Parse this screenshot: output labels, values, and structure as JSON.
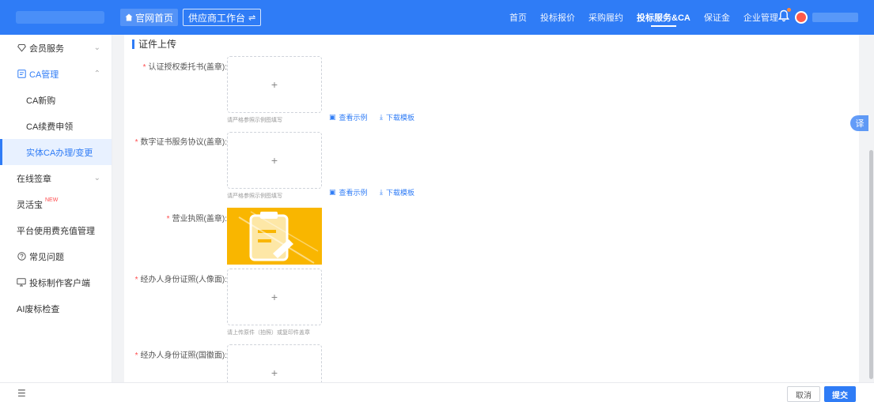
{
  "header": {
    "home_label": "官网首页",
    "workbench_label": "供应商工作台",
    "swap_icon": "⇌",
    "nav": [
      "首页",
      "投标报价",
      "采购履约",
      "投标服务&CA",
      "保证金",
      "企业管理"
    ],
    "active_nav": "投标服务&CA"
  },
  "sidebar": {
    "items": [
      {
        "label": "会员服务",
        "icon": "diamond-icon"
      },
      {
        "label": "CA管理",
        "icon": "ca-card-icon"
      },
      {
        "label": "CA新购"
      },
      {
        "label": "CA续费申领"
      },
      {
        "label": "实体CA办理/变更"
      },
      {
        "label": "在线签章"
      },
      {
        "label": "灵活宝",
        "badge": "NEW"
      },
      {
        "label": "平台使用费充值管理"
      },
      {
        "label": "常见问题",
        "icon": "question-icon"
      },
      {
        "label": "投标制作客户端",
        "icon": "monitor-icon"
      },
      {
        "label": "AI废标检查"
      }
    ]
  },
  "main": {
    "section_title": "证件上传",
    "fields": [
      {
        "label": "认证授权委托书(盖章):",
        "required": true,
        "hint": "请严格参照示例图填写",
        "view_example": "查看示例",
        "download": "下载模板"
      },
      {
        "label": "数字证书服务协议(盖章):",
        "required": true,
        "hint": "请严格参照示例图填写",
        "view_example": "查看示例",
        "download": "下载模板"
      },
      {
        "label": "营业执照(盖章):",
        "required": true
      },
      {
        "label": "经办人身份证照(人像面):",
        "required": true,
        "hint": "请上传原件（拍照）或复印件盖章"
      },
      {
        "label": "经办人身份证照(国徽面):",
        "required": true
      }
    ],
    "plus": "+",
    "req_mark": "*"
  },
  "float_button": "译",
  "footer": {
    "cancel": "取消",
    "submit": "提交"
  },
  "colors": {
    "primary": "#2f7cf6",
    "required": "#ff4d4f",
    "license_preview": "#f9b600"
  }
}
